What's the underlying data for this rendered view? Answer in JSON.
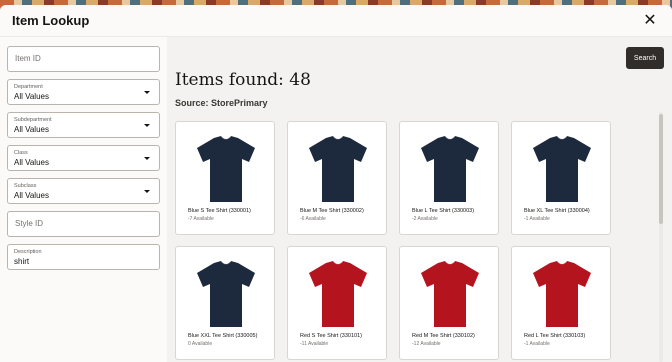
{
  "dialog": {
    "title": "Item Lookup"
  },
  "filters": {
    "item_id_placeholder": "Item ID",
    "department": {
      "label": "Department",
      "value": "All Values"
    },
    "subdepartment": {
      "label": "Subdepartment",
      "value": "All Values"
    },
    "class": {
      "label": "Class",
      "value": "All Values"
    },
    "subclass": {
      "label": "Subclass",
      "value": "All Values"
    },
    "style_id_placeholder": "Style ID",
    "description": {
      "label": "Description",
      "value": "shirt"
    }
  },
  "main": {
    "search_label": "Search",
    "items_found": "Items found: 48",
    "source": "Source: StorePrimary"
  },
  "items": [
    {
      "name": "Blue S Tee Shirt (330001)",
      "available": "-7 Available",
      "color": "navy"
    },
    {
      "name": "Blue M Tee Shirt (330002)",
      "available": "-6 Available",
      "color": "navy"
    },
    {
      "name": "Blue L Tee Shirt (330003)",
      "available": "-2 Available",
      "color": "navy"
    },
    {
      "name": "Blue XL Tee Shirt (330004)",
      "available": "-1 Available",
      "color": "navy"
    },
    {
      "name": "Blue XXL Tee Shirt (330005)",
      "available": "0 Available",
      "color": "navy"
    },
    {
      "name": "Red S Tee Shirt (330101)",
      "available": "-11 Available",
      "color": "red"
    },
    {
      "name": "Red M Tee Shirt (330102)",
      "available": "-12 Available",
      "color": "red"
    },
    {
      "name": "Red L Tee Shirt (330103)",
      "available": "-1 Available",
      "color": "red"
    }
  ],
  "colors": {
    "navy": "#1d2a3d",
    "red": "#b3141e"
  }
}
